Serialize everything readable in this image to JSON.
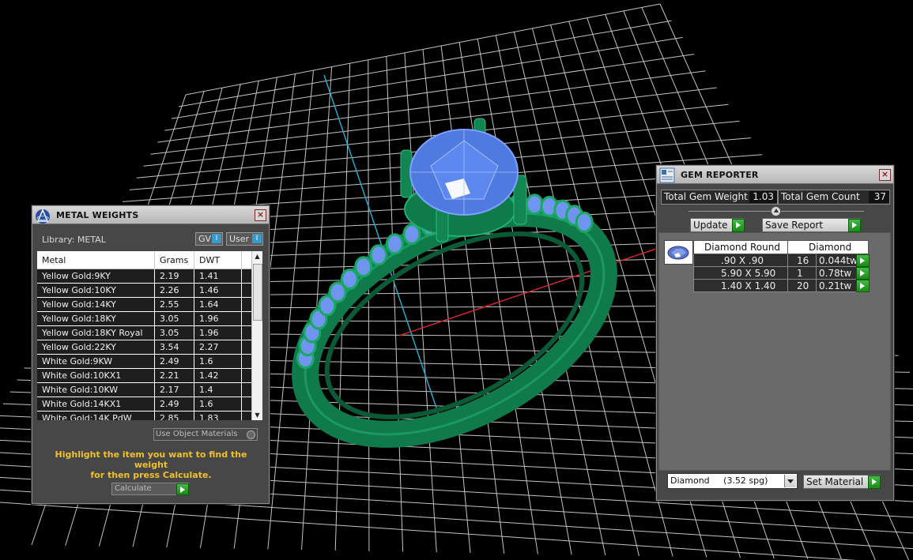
{
  "metal_panel": {
    "title": "METAL WEIGHTS",
    "library_label": "Library: METAL",
    "toggle_gv": "GV",
    "toggle_user": "User",
    "columns": [
      "Metal",
      "Grams",
      "DWT"
    ],
    "rows": [
      [
        "Yellow Gold:9KY",
        "2.19",
        "1.41"
      ],
      [
        "Yellow Gold:10KY",
        "2.26",
        "1.46"
      ],
      [
        "Yellow Gold:14KY",
        "2.55",
        "1.64"
      ],
      [
        "Yellow Gold:18KY",
        "3.05",
        "1.96"
      ],
      [
        "Yellow Gold:18KY Royal",
        "3.05",
        "1.96"
      ],
      [
        "Yellow Gold:22KY",
        "3.54",
        "2.27"
      ],
      [
        "White Gold:9KW",
        "2.49",
        "1.6"
      ],
      [
        "White Gold:10KX1",
        "2.21",
        "1.42"
      ],
      [
        "White Gold:10KW",
        "2.17",
        "1.4"
      ],
      [
        "White Gold:14KX1",
        "2.49",
        "1.6"
      ],
      [
        "White Gold:14K PdW",
        "2.85",
        "1.83"
      ]
    ],
    "use_object_materials": "Use Object Materials",
    "hint_line1": "Highlight the item you want to find the weight",
    "hint_line2": "for then press Calculate.",
    "calculate_label": "Calculate"
  },
  "gem_panel": {
    "title": "GEM REPORTER",
    "total_weight_label": "Total Gem Weight",
    "total_weight_value": "1.03",
    "total_count_label": "Total Gem Count",
    "total_count_value": "37",
    "update_label": "Update",
    "save_report_label": "Save Report",
    "table_header": [
      "Diamond Round",
      "Diamond"
    ],
    "rows": [
      [
        ".90 X .90",
        "16",
        "0.044tw"
      ],
      [
        "5.90 X 5.90",
        "1",
        "0.78tw"
      ],
      [
        "1.40 X 1.40",
        "20",
        "0.21tw"
      ]
    ],
    "material_selected": "Diamond     (3.52 spg)",
    "set_material_label": "Set Material"
  },
  "colors": {
    "accent_green": "#178d17",
    "hint_yellow": "#f0c12b",
    "gem_blue": "#4f7ae0",
    "metal_green": "#0f7a4a",
    "grid": "#e8e8e8"
  },
  "icons": {
    "metal_logo": "metal-weights-logo-icon",
    "gem_logo": "gem-reporter-logo-icon",
    "close": "close-icon",
    "arrow": "green-arrow-icon"
  }
}
